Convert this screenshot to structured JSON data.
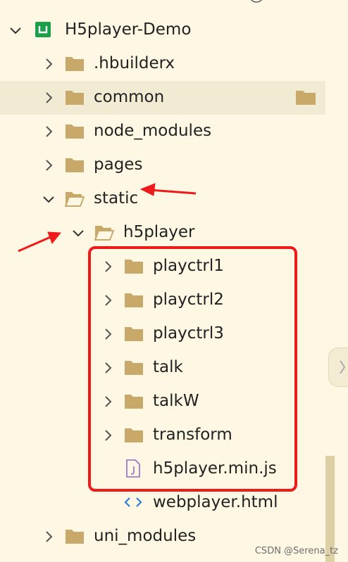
{
  "project": {
    "name": "H5player-Demo",
    "icon": "project-u-icon",
    "accent": "#1aa04b"
  },
  "tree": [
    {
      "key": "hbuilderx",
      "label": ".hbuilderx",
      "type": "folder",
      "expanded": false
    },
    {
      "key": "common",
      "label": "common",
      "type": "folder",
      "expanded": false,
      "hovered": true
    },
    {
      "key": "node_modules",
      "label": "node_modules",
      "type": "folder",
      "expanded": false
    },
    {
      "key": "pages",
      "label": "pages",
      "type": "folder",
      "expanded": false
    },
    {
      "key": "static",
      "label": "static",
      "type": "folder",
      "expanded": true
    },
    {
      "key": "h5player",
      "label": "h5player",
      "type": "folder",
      "expanded": true
    },
    {
      "key": "playctrl1",
      "label": "playctrl1",
      "type": "folder",
      "expanded": false
    },
    {
      "key": "playctrl2",
      "label": "playctrl2",
      "type": "folder",
      "expanded": false
    },
    {
      "key": "playctrl3",
      "label": "playctrl3",
      "type": "folder",
      "expanded": false
    },
    {
      "key": "talk",
      "label": "talk",
      "type": "folder",
      "expanded": false
    },
    {
      "key": "talkW",
      "label": "talkW",
      "type": "folder",
      "expanded": false
    },
    {
      "key": "transform",
      "label": "transform",
      "type": "folder",
      "expanded": false
    },
    {
      "key": "h5player_min_js",
      "label": "h5player.min.js",
      "type": "js-file"
    },
    {
      "key": "webplayer_html",
      "label": "webplayer.html",
      "type": "html-file"
    },
    {
      "key": "uni_modules",
      "label": "uni_modules",
      "type": "folder",
      "expanded": false
    }
  ],
  "watermark": "CSDN @Serena_tz",
  "colors": {
    "background": "#fdf7e3",
    "hover_row": "#f2ebd4",
    "folder": "#c9a96a",
    "annotation_red": "#ef1b1b",
    "js_icon": "#8b6bc4",
    "html_icon": "#2f7fd6"
  }
}
